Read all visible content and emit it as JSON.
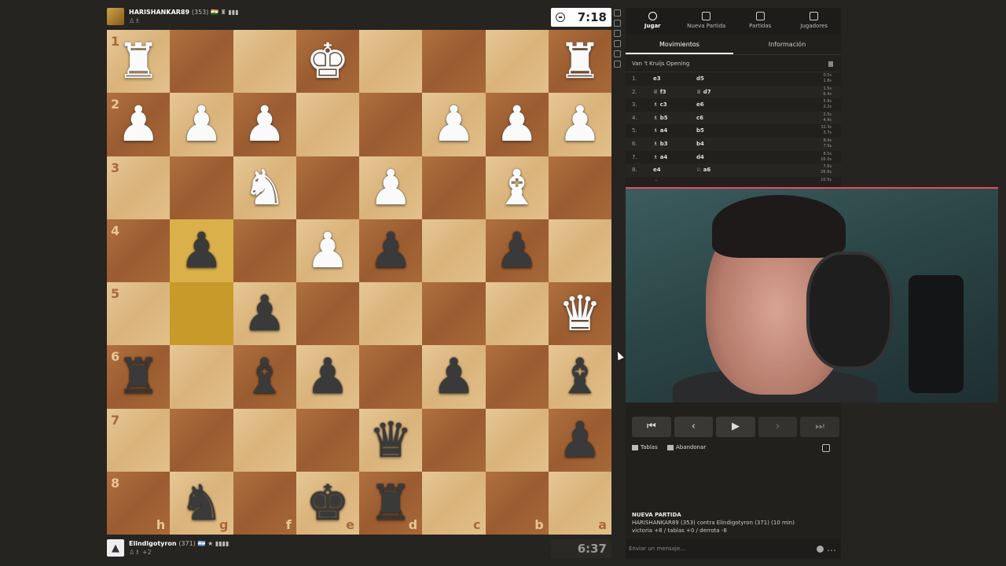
{
  "top_player": {
    "name": "HARISHANKAR89",
    "rating": "(353)",
    "flags": "🇮🇳 ♜ ▮▮▮",
    "sub": "♙♗",
    "clock": "7:18"
  },
  "bottom_player": {
    "name": "Elindigotyron",
    "rating": "(371)",
    "flags": "🇦🇷 ★ ▮▮▮▮",
    "sub": "♙♗ +2",
    "clock": "6:37"
  },
  "board": {
    "ranks": [
      "1",
      "2",
      "3",
      "4",
      "5",
      "6",
      "7",
      "8"
    ],
    "files": [
      "h",
      "g",
      "f",
      "e",
      "d",
      "c",
      "b",
      "a"
    ],
    "rows": [
      [
        {
          "p": "♜",
          "c": "w"
        },
        {
          "p": ""
        },
        {
          "p": ""
        },
        {
          "p": "♚",
          "c": "w"
        },
        {
          "p": ""
        },
        {
          "p": ""
        },
        {
          "p": ""
        },
        {
          "p": "♜",
          "c": "w"
        }
      ],
      [
        {
          "p": "♟",
          "c": "w"
        },
        {
          "p": "♟",
          "c": "w"
        },
        {
          "p": "♟",
          "c": "w"
        },
        {
          "p": ""
        },
        {
          "p": ""
        },
        {
          "p": "♟",
          "c": "w"
        },
        {
          "p": "♟",
          "c": "w"
        },
        {
          "p": "♟",
          "c": "w"
        }
      ],
      [
        {
          "p": ""
        },
        {
          "p": ""
        },
        {
          "p": "♞",
          "c": "w"
        },
        {
          "p": ""
        },
        {
          "p": "♟",
          "c": "w"
        },
        {
          "p": ""
        },
        {
          "p": "♝",
          "c": "w"
        },
        {
          "p": ""
        }
      ],
      [
        {
          "p": ""
        },
        {
          "p": "♟",
          "c": "b",
          "hl": true
        },
        {
          "p": ""
        },
        {
          "p": "♟",
          "c": "w"
        },
        {
          "p": "♟",
          "c": "b"
        },
        {
          "p": ""
        },
        {
          "p": "♟",
          "c": "b"
        },
        {
          "p": ""
        }
      ],
      [
        {
          "p": ""
        },
        {
          "p": "",
          "hl": true
        },
        {
          "p": "♟",
          "c": "b"
        },
        {
          "p": ""
        },
        {
          "p": ""
        },
        {
          "p": ""
        },
        {
          "p": ""
        },
        {
          "p": "♛",
          "c": "w"
        }
      ],
      [
        {
          "p": "♜",
          "c": "b"
        },
        {
          "p": ""
        },
        {
          "p": "♝",
          "c": "b"
        },
        {
          "p": "♟",
          "c": "b"
        },
        {
          "p": ""
        },
        {
          "p": "♟",
          "c": "b"
        },
        {
          "p": ""
        },
        {
          "p": "♝",
          "c": "b"
        }
      ],
      [
        {
          "p": ""
        },
        {
          "p": ""
        },
        {
          "p": ""
        },
        {
          "p": ""
        },
        {
          "p": "♛",
          "c": "b"
        },
        {
          "p": ""
        },
        {
          "p": ""
        },
        {
          "p": "♟",
          "c": "b"
        }
      ],
      [
        {
          "p": ""
        },
        {
          "p": "♞",
          "c": "b"
        },
        {
          "p": ""
        },
        {
          "p": "♚",
          "c": "b"
        },
        {
          "p": "♜",
          "c": "b"
        },
        {
          "p": ""
        },
        {
          "p": ""
        },
        {
          "p": ""
        }
      ]
    ]
  },
  "nav": {
    "items": [
      "Jugar",
      "Nueva Partida",
      "Partidas",
      "Jugadores"
    ]
  },
  "tabs": {
    "moves": "Movimientos",
    "info": "Información"
  },
  "opening": "Van 't Kruijs Opening",
  "moves": [
    {
      "n": "1.",
      "w": "e3",
      "b": "d5",
      "t1": "0.5s",
      "t2": "1.8s"
    },
    {
      "n": "2.",
      "w": "♕ f3",
      "b": "♕ d7",
      "t1": "1.5s",
      "t2": "6.4s"
    },
    {
      "n": "3.",
      "w": "♗ c3",
      "b": "e6",
      "t1": "5.9s",
      "t2": "2.2s"
    },
    {
      "n": "4.",
      "w": "♗ b5",
      "b": "c6",
      "t1": "2.5s",
      "t2": "4.4s"
    },
    {
      "n": "5.",
      "w": "♗ a4",
      "b": "b5",
      "t1": "32.3s",
      "t2": "3.7s"
    },
    {
      "n": "6.",
      "w": "♗ b3",
      "b": "b4",
      "t1": "8.4s",
      "t2": "7.5s"
    },
    {
      "n": "7.",
      "w": "♗ a4",
      "b": "d4",
      "t1": "8.5s",
      "t2": "16.0s"
    },
    {
      "n": "8.",
      "w": "e4",
      "b": "♘ a6",
      "t1": "7.6s",
      "t2": "26.6s"
    },
    {
      "n": "9.",
      "w": "d3",
      "b": "♘ c5",
      "t1": "10.5s",
      "t2": ""
    }
  ],
  "controls": {
    "first": "⏮",
    "prev": "‹",
    "play": "▶",
    "next": "›",
    "last": "⏭"
  },
  "actions": {
    "draw": "Tablas",
    "resign": "Abandonar"
  },
  "chat": {
    "title": "NUEVA PARTIDA",
    "line1": "HARISHANKAR89 (353) contra Elindigotyron (371) (10 min)",
    "line2": "victoria +8 / tablas +0 / derrota -8",
    "placeholder": "Enviar un mensaje..."
  },
  "colors": {
    "accent": "#e84c5a",
    "light_square": "#e7c795",
    "dark_square": "#a86938",
    "highlight": "#d9b04a"
  }
}
